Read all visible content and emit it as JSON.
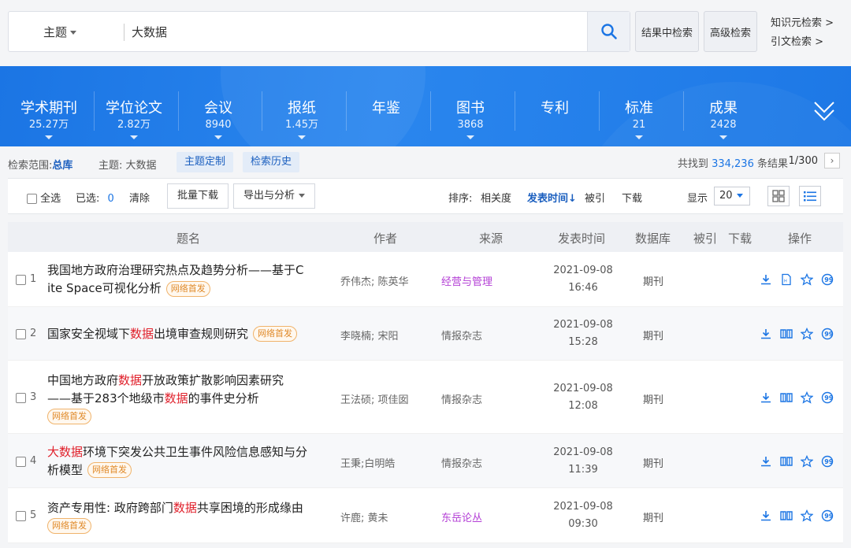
{
  "search": {
    "field": "主题",
    "query": "大数据",
    "result_search_label": "结果中检索",
    "advanced_label": "高级检索",
    "knowledge_link": "知识元检索 >",
    "citation_link": "引文检索 >"
  },
  "nav": [
    {
      "label": "学术期刊",
      "count": "25.27万"
    },
    {
      "label": "学位论文",
      "count": "2.82万"
    },
    {
      "label": "会议",
      "count": "8940"
    },
    {
      "label": "报纸",
      "count": "1.45万"
    },
    {
      "label": "年鉴",
      "count": ""
    },
    {
      "label": "图书",
      "count": "3868"
    },
    {
      "label": "专利",
      "count": ""
    },
    {
      "label": "标准",
      "count": "21"
    },
    {
      "label": "成果",
      "count": "2428"
    }
  ],
  "info": {
    "scope_label": "检索范围:",
    "scope_value": "总库",
    "topic_label": "主题: 大数据",
    "custom_label": "主题定制",
    "history_label": "检索历史",
    "found_prefix": "共找到",
    "found_count": "334,236",
    "found_suffix": "条结果",
    "page": "1/300"
  },
  "toolbar": {
    "select_all": "全选",
    "selected_label": "已选:",
    "selected_count": "0",
    "clear": "清除",
    "batch_download": "批量下载",
    "export_analysis": "导出与分析",
    "sort_label": "排序:",
    "sort_relevance": "相关度",
    "sort_date": "发表时间↓",
    "sort_cited": "被引",
    "sort_download": "下载",
    "display_label": "显示",
    "page_size": "20"
  },
  "table": {
    "headers": {
      "title": "题名",
      "author": "作者",
      "source": "来源",
      "date": "发表时间",
      "database": "数据库",
      "cited": "被引",
      "download": "下载",
      "ops": "操作"
    },
    "badge": "网络首发",
    "rows": [
      {
        "num": "1",
        "t1": "我国地方政府治理研究热点及趋势分析——基于C",
        "t2": "ite Space可视化分析",
        "author": "乔伟杰; 陈英华",
        "source": "经营与管理",
        "date": "2021-09-08",
        "time": "16:46",
        "db": "期刊"
      },
      {
        "num": "2",
        "tpre": "国家安全视域下",
        "thl": "数据",
        "tpost": "出境审查规则研究",
        "author": "李晓楠; 宋阳",
        "source": "情报杂志",
        "date": "2021-09-08",
        "time": "15:28",
        "db": "期刊"
      },
      {
        "num": "3",
        "tpre": "中国地方政府",
        "thl": "数据",
        "tpost": "开放政策扩散影响因素研究",
        "t2pre": "——基于283个地级市",
        "t2hl": "数据",
        "t2post": "的事件史分析",
        "author": "王法硕; 项佳囡",
        "source": "情报杂志",
        "date": "2021-09-08",
        "time": "12:08",
        "db": "期刊"
      },
      {
        "num": "4",
        "thl": "大数据",
        "tpost": "环境下突发公共卫生事件风险信息感知与分",
        "t2": "析模型",
        "author": "王秉;白明皓",
        "source": "情报杂志",
        "date": "2021-09-08",
        "time": "11:39",
        "db": "期刊"
      },
      {
        "num": "5",
        "tpre": "资产专用性: 政府跨部门",
        "thl": "数据",
        "tpost": "共享困境的形成缘由",
        "author": "许鹿; 黄未",
        "source": "东岳论丛",
        "date": "2021-09-08",
        "time": "09:30",
        "db": "期刊"
      }
    ]
  },
  "colors": {
    "brand_blue": "#1b75e4",
    "highlight": "#e0202b",
    "source_purple": "#b440d6",
    "badge_orange": "#e08a2a"
  }
}
